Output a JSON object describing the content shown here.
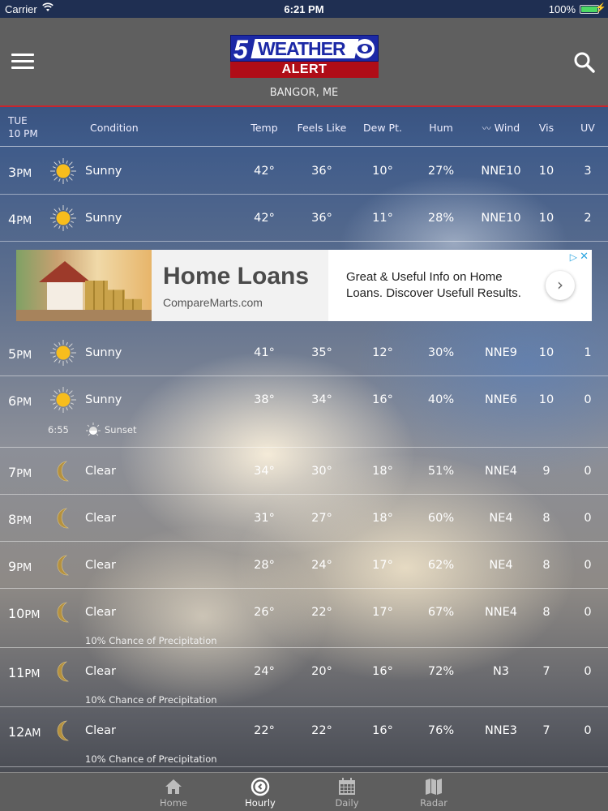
{
  "status_bar": {
    "carrier": "Carrier",
    "time": "6:21 PM",
    "battery": "100%",
    "battery_color": "#4cd964"
  },
  "header": {
    "logo_number": "5",
    "logo_word": "WEATHER",
    "logo_alert": "ALERT",
    "location": "BANGOR, ME",
    "accent_color": "#c8262d"
  },
  "table_header": {
    "day": "TUE",
    "time": "10 PM",
    "condition": "Condition",
    "temp": "Temp",
    "feels_like": "Feels Like",
    "dew_point": "Dew Pt.",
    "humidity": "Hum",
    "wind": "Wind",
    "visibility": "Vis",
    "uv": "UV"
  },
  "rows": [
    {
      "hour": "3",
      "ampm": "PM",
      "icon": "sun-icon",
      "condition": "Sunny",
      "temp": "42°",
      "feels": "36°",
      "dew": "10°",
      "hum": "27%",
      "wind": "NNE10",
      "vis": "10",
      "uv": "3"
    },
    {
      "hour": "4",
      "ampm": "PM",
      "icon": "sun-icon",
      "condition": "Sunny",
      "temp": "42°",
      "feels": "36°",
      "dew": "11°",
      "hum": "28%",
      "wind": "NNE10",
      "vis": "10",
      "uv": "2"
    },
    {
      "hour": "5",
      "ampm": "PM",
      "icon": "sun-icon",
      "condition": "Sunny",
      "temp": "41°",
      "feels": "35°",
      "dew": "12°",
      "hum": "30%",
      "wind": "NNE9",
      "vis": "10",
      "uv": "1"
    },
    {
      "hour": "6",
      "ampm": "PM",
      "icon": "sun-icon",
      "condition": "Sunny",
      "temp": "38°",
      "feels": "34°",
      "dew": "16°",
      "hum": "40%",
      "wind": "NNE6",
      "vis": "10",
      "uv": "0",
      "sunset_time": "6:55",
      "sunset_label": "Sunset"
    },
    {
      "hour": "7",
      "ampm": "PM",
      "icon": "moon-icon",
      "condition": "Clear",
      "temp": "34°",
      "feels": "30°",
      "dew": "18°",
      "hum": "51%",
      "wind": "NNE4",
      "vis": "9",
      "uv": "0"
    },
    {
      "hour": "8",
      "ampm": "PM",
      "icon": "moon-icon",
      "condition": "Clear",
      "temp": "31°",
      "feels": "27°",
      "dew": "18°",
      "hum": "60%",
      "wind": "NE4",
      "vis": "8",
      "uv": "0"
    },
    {
      "hour": "9",
      "ampm": "PM",
      "icon": "moon-icon",
      "condition": "Clear",
      "temp": "28°",
      "feels": "24°",
      "dew": "17°",
      "hum": "62%",
      "wind": "NE4",
      "vis": "8",
      "uv": "0"
    },
    {
      "hour": "10",
      "ampm": "PM",
      "icon": "moon-icon",
      "condition": "Clear",
      "temp": "26°",
      "feels": "22°",
      "dew": "17°",
      "hum": "67%",
      "wind": "NNE4",
      "vis": "8",
      "uv": "0",
      "precip": "10% Chance of Precipitation"
    },
    {
      "hour": "11",
      "ampm": "PM",
      "icon": "moon-icon",
      "condition": "Clear",
      "temp": "24°",
      "feels": "20°",
      "dew": "16°",
      "hum": "72%",
      "wind": "N3",
      "vis": "7",
      "uv": "0",
      "precip": "10% Chance of Precipitation"
    },
    {
      "hour": "12",
      "ampm": "AM",
      "icon": "moon-icon",
      "condition": "Clear",
      "temp": "22°",
      "feels": "22°",
      "dew": "16°",
      "hum": "76%",
      "wind": "NNE3",
      "vis": "7",
      "uv": "0",
      "precip": "10% Chance of Precipitation"
    }
  ],
  "ad": {
    "title": "Home Loans",
    "domain": "CompareMarts.com",
    "description": "Great & Useful Info on Home Loans. Discover Usefull Results.",
    "arrow": "›",
    "adchoices": "▷",
    "close": "✕"
  },
  "tabs": [
    {
      "label": "Home",
      "icon": "home-icon",
      "active": false
    },
    {
      "label": "Hourly",
      "icon": "clock-icon",
      "active": true
    },
    {
      "label": "Daily",
      "icon": "calendar-icon",
      "active": false
    },
    {
      "label": "Radar",
      "icon": "map-icon",
      "active": false
    }
  ],
  "colors": {
    "sun": "#f7bd1d",
    "moon": "#b5913e",
    "header_bg": "#5f5f5f",
    "tabbar_bg": "#5e5e5e"
  }
}
